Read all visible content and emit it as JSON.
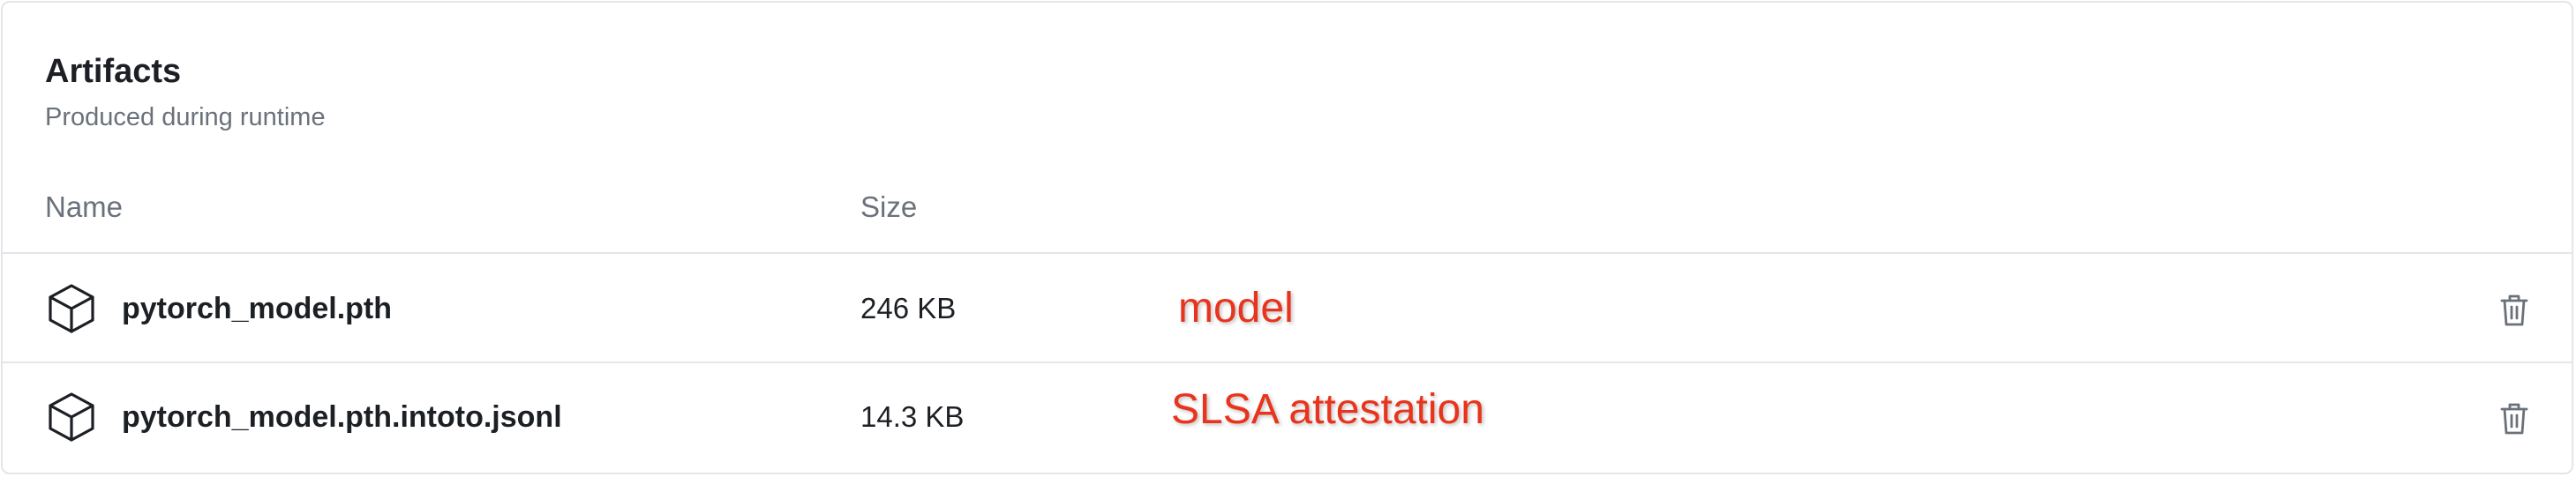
{
  "section": {
    "title": "Artifacts",
    "subtitle": "Produced during runtime"
  },
  "table": {
    "columns": {
      "name": "Name",
      "size": "Size"
    },
    "rows": [
      {
        "icon": "package-icon",
        "name": "pytorch_model.pth",
        "size": "246 KB",
        "annotation": "model",
        "action_icon": "trash-icon"
      },
      {
        "icon": "package-icon",
        "name": "pytorch_model.pth.intoto.jsonl",
        "size": "14.3 KB",
        "annotation": "SLSA attestation",
        "action_icon": "trash-icon"
      }
    ]
  },
  "colors": {
    "annotation": "#e8341c",
    "border": "#e3e5e8",
    "text_primary": "#1c1f24",
    "text_secondary": "#6b717b"
  }
}
